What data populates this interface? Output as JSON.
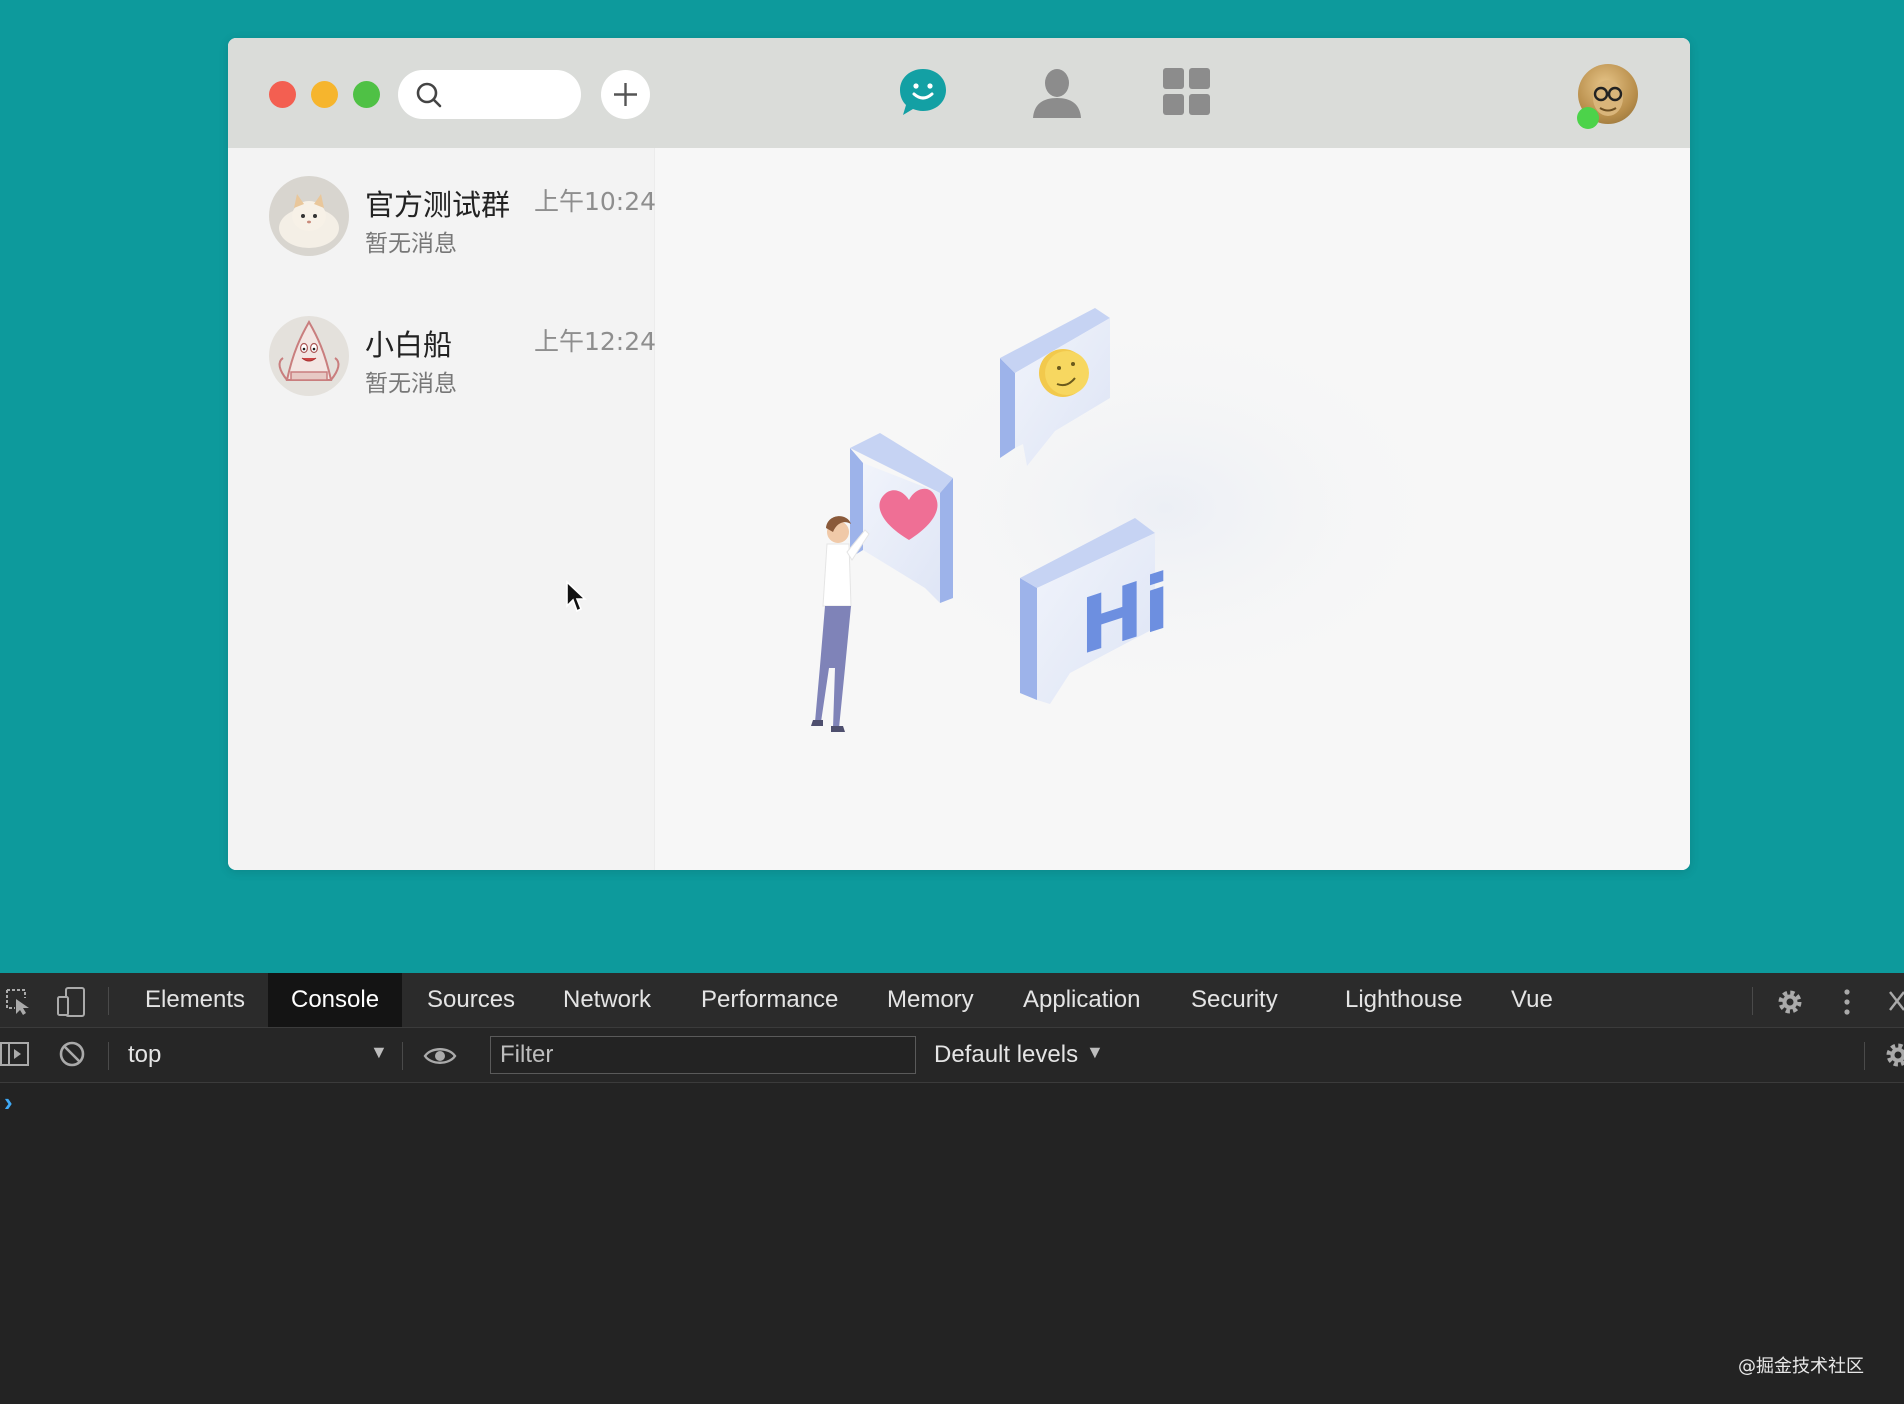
{
  "app": {
    "window_controls": [
      "close",
      "minimize",
      "maximize"
    ],
    "search": {
      "placeholder": "",
      "icon": "search-icon"
    },
    "add_button_icon": "plus-icon",
    "nav": [
      {
        "id": "chat",
        "icon": "chat-bubble-icon",
        "active": true,
        "color": "#13a0a4"
      },
      {
        "id": "contacts",
        "icon": "person-icon",
        "active": false,
        "color": "#8c8c8c"
      },
      {
        "id": "apps",
        "icon": "grid-icon",
        "active": false,
        "color": "#8c8c8c"
      }
    ],
    "user": {
      "online": true,
      "status_color": "#4cd34a"
    },
    "chats": [
      {
        "name": "官方测试群",
        "time": "上午10:24",
        "preview": "暂无消息",
        "avatar": "cat-avatar"
      },
      {
        "name": "小白船",
        "time": "上午12:24",
        "preview": "暂无消息",
        "avatar": "patrick-avatar"
      }
    ],
    "illustration": {
      "bubble_text": "Hi"
    }
  },
  "devtools": {
    "tabs": [
      "Elements",
      "Console",
      "Sources",
      "Network",
      "Performance",
      "Memory",
      "Application",
      "Security",
      "Lighthouse",
      "Vue"
    ],
    "active_tab": "Console",
    "toolbar": {
      "context": "top",
      "filter_placeholder": "Filter",
      "levels": "Default levels"
    },
    "prompt": "›"
  },
  "watermark": "@掘金技术社区"
}
